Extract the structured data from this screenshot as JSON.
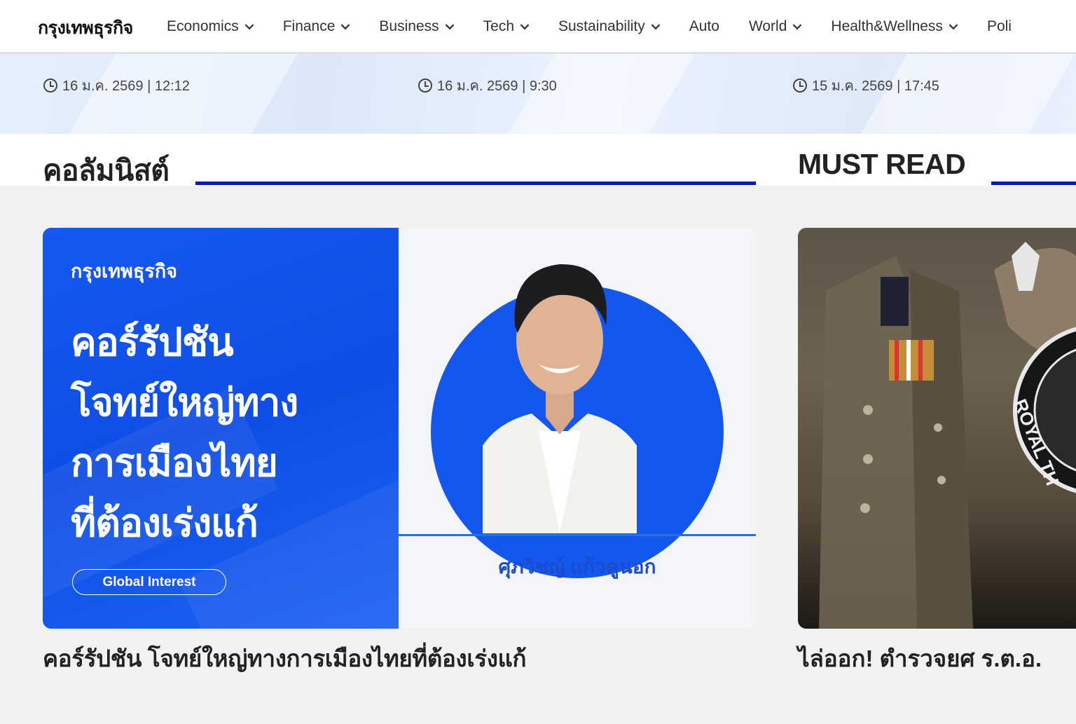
{
  "nav": {
    "brand": "กรุงเทพธุรกิจ",
    "items": [
      {
        "label": "Economics",
        "dropdown": true
      },
      {
        "label": "Finance",
        "dropdown": true
      },
      {
        "label": "Business",
        "dropdown": true
      },
      {
        "label": "Tech",
        "dropdown": true
      },
      {
        "label": "Sustainability",
        "dropdown": true
      },
      {
        "label": "Auto",
        "dropdown": false
      },
      {
        "label": "World",
        "dropdown": true
      },
      {
        "label": "Health&Wellness",
        "dropdown": true
      },
      {
        "label": "Poli",
        "dropdown": false
      }
    ]
  },
  "dates": [
    "16 ม.ค. 2569 | 12:12",
    "16 ม.ค. 2569 | 9:30",
    "15 ม.ค. 2569 | 17:45"
  ],
  "columnists": {
    "title": "คอลัมนิสต์",
    "card": {
      "brand": "กรุงเทพธุรกิจ",
      "headline_lines": [
        "คอร์รัปชัน",
        "โจทย์ใหญ่ทาง",
        "การเมืองไทย",
        "ที่ต้องเร่งแก้"
      ],
      "tag": "Global Interest",
      "author": "ศุภวิชญ์ แก้วคูนอก"
    },
    "headline": "คอร์รัปชัน โจทย์ใหญ่ทางการเมืองไทยที่ต้องเร่งแก้"
  },
  "must_read": {
    "title": "MUST READ",
    "image_text": "ROYAL TH",
    "headline": "ไล่ออก! ตำรวจยศ ร.ต.อ."
  },
  "colors": {
    "accent_line": "#0a1ab4",
    "card_blue": "#1457ee",
    "author_blue": "#1a4ccc"
  }
}
